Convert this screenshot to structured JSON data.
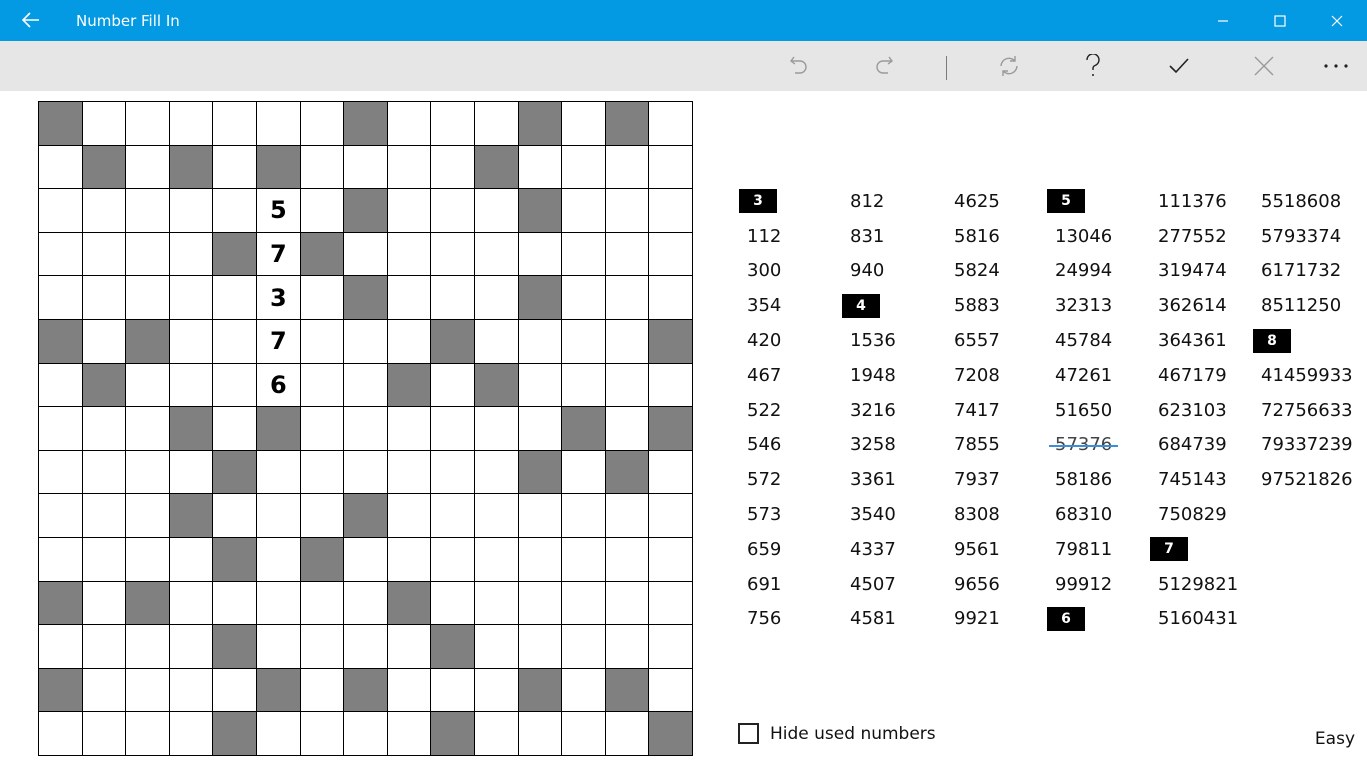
{
  "window": {
    "title": "Number Fill In"
  },
  "grid": {
    "size": 15,
    "blacks": [
      [
        0,
        0
      ],
      [
        0,
        7
      ],
      [
        0,
        11
      ],
      [
        0,
        13
      ],
      [
        1,
        1
      ],
      [
        1,
        3
      ],
      [
        1,
        5
      ],
      [
        1,
        10
      ],
      [
        2,
        7
      ],
      [
        2,
        11
      ],
      [
        3,
        4
      ],
      [
        3,
        6
      ],
      [
        4,
        7
      ],
      [
        4,
        11
      ],
      [
        5,
        0
      ],
      [
        5,
        2
      ],
      [
        5,
        9
      ],
      [
        5,
        14
      ],
      [
        6,
        1
      ],
      [
        6,
        8
      ],
      [
        6,
        10
      ],
      [
        7,
        3
      ],
      [
        7,
        5
      ],
      [
        7,
        12
      ],
      [
        7,
        14
      ],
      [
        8,
        4
      ],
      [
        8,
        11
      ],
      [
        8,
        13
      ],
      [
        9,
        3
      ],
      [
        9,
        7
      ],
      [
        10,
        4
      ],
      [
        10,
        6
      ],
      [
        11,
        0
      ],
      [
        11,
        2
      ],
      [
        11,
        8
      ],
      [
        12,
        4
      ],
      [
        12,
        9
      ],
      [
        13,
        0
      ],
      [
        13,
        5
      ],
      [
        13,
        7
      ],
      [
        13,
        11
      ],
      [
        13,
        13
      ],
      [
        14,
        4
      ],
      [
        14,
        9
      ],
      [
        14,
        14
      ]
    ],
    "filled": [
      {
        "r": 2,
        "c": 5,
        "v": "5"
      },
      {
        "r": 3,
        "c": 5,
        "v": "7"
      },
      {
        "r": 4,
        "c": 5,
        "v": "3"
      },
      {
        "r": 5,
        "c": 5,
        "v": "7"
      },
      {
        "r": 6,
        "c": 5,
        "v": "6"
      }
    ]
  },
  "number_list": {
    "columns": [
      [
        {
          "type": "header",
          "text": "3"
        },
        {
          "text": "112"
        },
        {
          "text": "300"
        },
        {
          "text": "354"
        },
        {
          "text": "420"
        },
        {
          "text": "467"
        },
        {
          "text": "522"
        },
        {
          "text": "546"
        },
        {
          "text": "572"
        },
        {
          "text": "573"
        },
        {
          "text": "659"
        },
        {
          "text": "691"
        },
        {
          "text": "756"
        }
      ],
      [
        {
          "text": "812"
        },
        {
          "text": "831"
        },
        {
          "text": "940"
        },
        {
          "type": "header",
          "text": "4"
        },
        {
          "text": "1536"
        },
        {
          "text": "1948"
        },
        {
          "text": "3216"
        },
        {
          "text": "3258"
        },
        {
          "text": "3361"
        },
        {
          "text": "3540"
        },
        {
          "text": "4337"
        },
        {
          "text": "4507"
        },
        {
          "text": "4581"
        }
      ],
      [
        {
          "text": "4625"
        },
        {
          "text": "5816"
        },
        {
          "text": "5824"
        },
        {
          "text": "5883"
        },
        {
          "text": "6557"
        },
        {
          "text": "7208"
        },
        {
          "text": "7417"
        },
        {
          "text": "7855"
        },
        {
          "text": "7937"
        },
        {
          "text": "8308"
        },
        {
          "text": "9561"
        },
        {
          "text": "9656"
        },
        {
          "text": "9921"
        }
      ],
      [
        {
          "type": "header",
          "text": "5"
        },
        {
          "text": "13046"
        },
        {
          "text": "24994"
        },
        {
          "text": "32313"
        },
        {
          "text": "45784"
        },
        {
          "text": "47261"
        },
        {
          "text": "51650"
        },
        {
          "text": "57376",
          "used": true
        },
        {
          "text": "58186"
        },
        {
          "text": "68310"
        },
        {
          "text": "79811"
        },
        {
          "text": "99912"
        },
        {
          "type": "header",
          "text": "6"
        }
      ],
      [
        {
          "text": "111376"
        },
        {
          "text": "277552"
        },
        {
          "text": "319474"
        },
        {
          "text": "362614"
        },
        {
          "text": "364361"
        },
        {
          "text": "467179"
        },
        {
          "text": "623103"
        },
        {
          "text": "684739"
        },
        {
          "text": "745143"
        },
        {
          "text": "750829"
        },
        {
          "type": "header",
          "text": "7"
        },
        {
          "text": "5129821"
        },
        {
          "text": "5160431"
        }
      ],
      [
        {
          "text": "5518608"
        },
        {
          "text": "5793374"
        },
        {
          "text": "6171732"
        },
        {
          "text": "8511250"
        },
        {
          "type": "header",
          "text": "8"
        },
        {
          "text": "41459933"
        },
        {
          "text": "72756633"
        },
        {
          "text": "79337239"
        },
        {
          "text": "97521826"
        }
      ]
    ]
  },
  "options": {
    "hide_used_label": "Hide used numbers",
    "difficulty": "Easy"
  },
  "colors": {
    "titlebar": "#039ae3",
    "toolbar": "#e6e6e6",
    "block": "#808080",
    "strike": "#3b8fd9"
  }
}
